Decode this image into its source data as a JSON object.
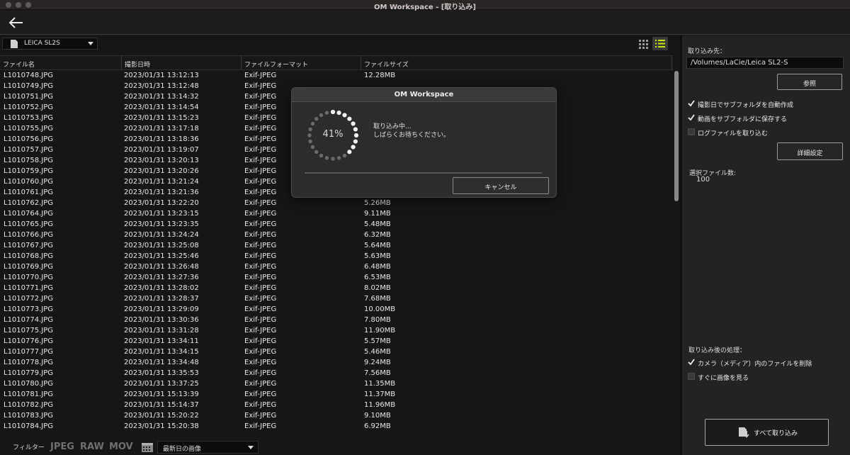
{
  "window": {
    "title": "OM Workspace - [取り込み]"
  },
  "camera": {
    "selected": "LEICA SL2S"
  },
  "table": {
    "headers": [
      "ファイル名",
      "撮影日時",
      "ファイルフォーマット",
      "ファイルサイズ"
    ],
    "rows": [
      [
        "L1010748.JPG",
        "2023/01/31 13:12:13",
        "Exif-JPEG",
        "12.28MB"
      ],
      [
        "L1010749.JPG",
        "2023/01/31 13:12:48",
        "Exif-JPEG",
        ""
      ],
      [
        "L1010751.JPG",
        "2023/01/31 13:14:32",
        "Exif-JPEG",
        ""
      ],
      [
        "L1010752.JPG",
        "2023/01/31 13:14:54",
        "Exif-JPEG",
        ""
      ],
      [
        "L1010753.JPG",
        "2023/01/31 13:15:23",
        "Exif-JPEG",
        ""
      ],
      [
        "L1010755.JPG",
        "2023/01/31 13:17:18",
        "Exif-JPEG",
        ""
      ],
      [
        "L1010756.JPG",
        "2023/01/31 13:18:36",
        "Exif-JPEG",
        ""
      ],
      [
        "L1010757.JPG",
        "2023/01/31 13:19:07",
        "Exif-JPEG",
        ""
      ],
      [
        "L1010758.JPG",
        "2023/01/31 13:20:13",
        "Exif-JPEG",
        ""
      ],
      [
        "L1010759.JPG",
        "2023/01/31 13:20:26",
        "Exif-JPEG",
        ""
      ],
      [
        "L1010760.JPG",
        "2023/01/31 13:21:24",
        "Exif-JPEG",
        ""
      ],
      [
        "L1010761.JPG",
        "2023/01/31 13:21:36",
        "Exif-JPEG",
        ""
      ],
      [
        "L1010762.JPG",
        "2023/01/31 13:22:20",
        "Exif-JPEG",
        "5.26MB"
      ],
      [
        "L1010764.JPG",
        "2023/01/31 13:23:15",
        "Exif-JPEG",
        "9.11MB"
      ],
      [
        "L1010765.JPG",
        "2023/01/31 13:23:35",
        "Exif-JPEG",
        "5.48MB"
      ],
      [
        "L1010766.JPG",
        "2023/01/31 13:24:24",
        "Exif-JPEG",
        "6.32MB"
      ],
      [
        "L1010767.JPG",
        "2023/01/31 13:25:08",
        "Exif-JPEG",
        "5.64MB"
      ],
      [
        "L1010768.JPG",
        "2023/01/31 13:25:46",
        "Exif-JPEG",
        "5.63MB"
      ],
      [
        "L1010769.JPG",
        "2023/01/31 13:26:48",
        "Exif-JPEG",
        "6.48MB"
      ],
      [
        "L1010770.JPG",
        "2023/01/31 13:27:36",
        "Exif-JPEG",
        "6.53MB"
      ],
      [
        "L1010771.JPG",
        "2023/01/31 13:28:02",
        "Exif-JPEG",
        "8.02MB"
      ],
      [
        "L1010772.JPG",
        "2023/01/31 13:28:37",
        "Exif-JPEG",
        "7.68MB"
      ],
      [
        "L1010773.JPG",
        "2023/01/31 13:29:09",
        "Exif-JPEG",
        "10.00MB"
      ],
      [
        "L1010774.JPG",
        "2023/01/31 13:30:36",
        "Exif-JPEG",
        "7.80MB"
      ],
      [
        "L1010775.JPG",
        "2023/01/31 13:31:28",
        "Exif-JPEG",
        "11.90MB"
      ],
      [
        "L1010776.JPG",
        "2023/01/31 13:34:11",
        "Exif-JPEG",
        "5.57MB"
      ],
      [
        "L1010777.JPG",
        "2023/01/31 13:34:15",
        "Exif-JPEG",
        "5.46MB"
      ],
      [
        "L1010778.JPG",
        "2023/01/31 13:34:48",
        "Exif-JPEG",
        "9.24MB"
      ],
      [
        "L1010779.JPG",
        "2023/01/31 13:35:53",
        "Exif-JPEG",
        "7.56MB"
      ],
      [
        "L1010780.JPG",
        "2023/01/31 13:37:25",
        "Exif-JPEG",
        "11.35MB"
      ],
      [
        "L1010781.JPG",
        "2023/01/31 15:13:39",
        "Exif-JPEG",
        "11.37MB"
      ],
      [
        "L1010782.JPG",
        "2023/01/31 15:14:37",
        "Exif-JPEG",
        "11.96MB"
      ],
      [
        "L1010783.JPG",
        "2023/01/31 15:20:22",
        "Exif-JPEG",
        "9.10MB"
      ],
      [
        "L1010784.JPG",
        "2023/01/31 15:20:38",
        "Exif-JPEG",
        "6.92MB"
      ]
    ]
  },
  "filter": {
    "label": "フィルター",
    "types": [
      "JPEG",
      "RAW",
      "MOV"
    ],
    "date_selected": "最新日の画像"
  },
  "right": {
    "dest_label": "取り込み先：",
    "dest_path": "/Volumes/LaCie/Leica SL2-S",
    "browse": "参照",
    "options": [
      {
        "label": "撮影日でサブフォルダを自動作成",
        "checked": true
      },
      {
        "label": "動画をサブフォルダに保存する",
        "checked": true
      },
      {
        "label": "ログファイルを取り込む",
        "checked": false
      }
    ],
    "advanced": "詳細設定",
    "selected_count_label": "選択ファイル数:",
    "selected_count": "100",
    "after_label": "取り込み後の処理：",
    "after_options": [
      {
        "label": "カメラ（メディア）内のファイルを削除",
        "checked": true
      },
      {
        "label": "すぐに画像を見る",
        "checked": false
      }
    ],
    "import_all": "すべて取り込み"
  },
  "dialog": {
    "title": "OM Workspace",
    "percent_text": "41%",
    "progress_fraction": 0.41,
    "message_line1": "取り込み中...",
    "message_line2": "しばらくお待ちください。",
    "cancel": "キャンセル"
  }
}
